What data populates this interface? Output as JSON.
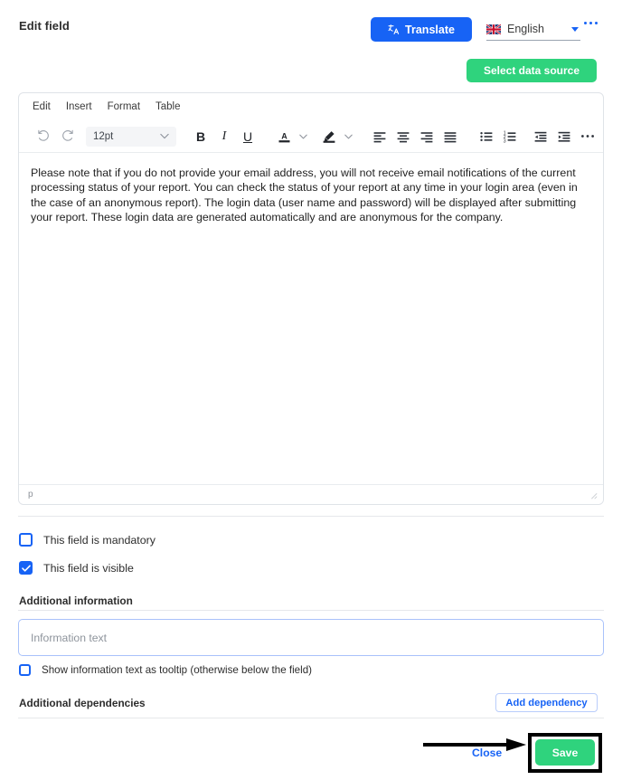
{
  "header": {
    "title": "Edit field",
    "translate_label": "Translate",
    "translate_icon": "translate-icon",
    "language": "English",
    "flag_icon": "uk-flag-icon",
    "caret_icon": "chevron-down-icon",
    "overflow_icon": "more-horizontal-icon",
    "accent_blue": "#1763F5"
  },
  "datasource": {
    "label": "Select data source",
    "color": "#2FD37D"
  },
  "editor": {
    "menus": [
      "Edit",
      "Insert",
      "Format",
      "Table"
    ],
    "toolbar": {
      "undo_icon": "undo-icon",
      "redo_icon": "redo-icon",
      "fontsize_value": "12pt",
      "fontsize_caret": "chevron-down-icon",
      "bold_label": "B",
      "italic_label": "I",
      "underline_label": "U",
      "text_color_icon": "text-color-icon",
      "text_color_caret": "chevron-down-icon",
      "highlight_icon": "highlight-color-icon",
      "highlight_caret": "chevron-down-icon",
      "align_left_icon": "align-left-icon",
      "align_center_icon": "align-center-icon",
      "align_right_icon": "align-right-icon",
      "align_justify_icon": "align-justify-icon",
      "bullet_list_icon": "bullet-list-icon",
      "numbered_list_icon": "numbered-list-icon",
      "outdent_icon": "decrease-indent-icon",
      "indent_icon": "increase-indent-icon",
      "more_icon": "more-horizontal-icon"
    },
    "content": "Please note that if you do not provide your email address, you will not receive email notifications of the current processing status of your report. You can check the status of your report at any time in your login area (even in the case of an anonymous report). The login data (user name and password) will be displayed after submitting your report. These login data are generated automatically and are anonymous for the company.",
    "status_path": "p",
    "resize_icon": "resize-handle-icon"
  },
  "options": {
    "mandatory_label": "This field is mandatory",
    "mandatory_checked": false,
    "visible_label": "This field is visible",
    "visible_checked": true,
    "checkbox_color": "#1763F5"
  },
  "additional_information": {
    "heading": "Additional information",
    "input_value": "",
    "input_placeholder": "Information text",
    "tooltip_label": "Show information text as tooltip (otherwise below the field)",
    "tooltip_checked": false
  },
  "additional_dependencies": {
    "heading": "Additional dependencies",
    "add_label": "Add dependency"
  },
  "footer": {
    "close_label": "Close",
    "save_label": "Save",
    "save_color": "#2FD37D",
    "annotation_arrow_icon": "arrow-right-annotation-icon",
    "annotation_box_icon": "highlight-box-annotation-icon"
  }
}
